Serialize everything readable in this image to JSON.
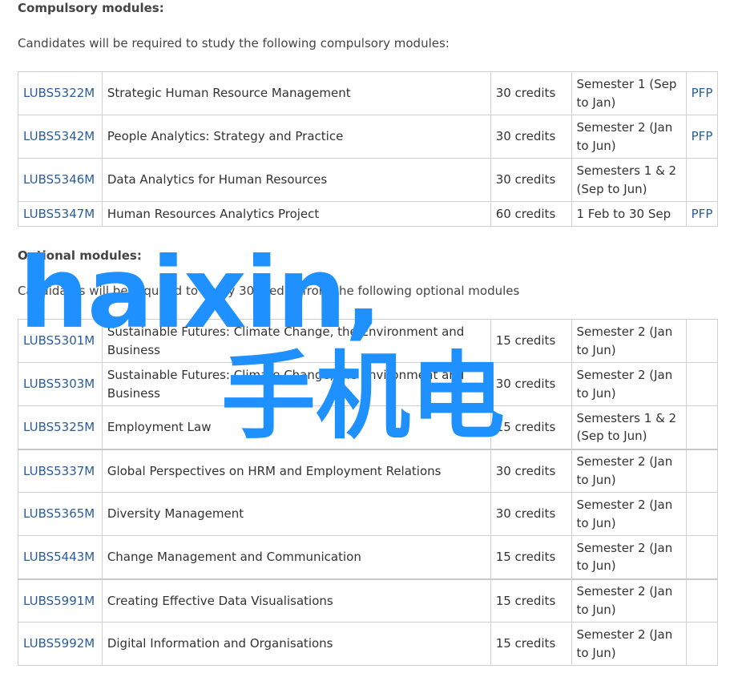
{
  "compulsory": {
    "heading": "Compulsory modules:",
    "intro": "Candidates will be required to study the following compulsory modules:",
    "rows": [
      {
        "code": "LUBS5322M",
        "title": "Strategic Human Resource Management",
        "credits": "30 credits",
        "semester": "Semester 1 (Sep to Jan)",
        "pfp": "PFP"
      },
      {
        "code": "LUBS5342M",
        "title": "People Analytics: Strategy and Practice",
        "credits": "30 credits",
        "semester": "Semester 2 (Jan to Jun)",
        "pfp": "PFP"
      },
      {
        "code": "LUBS5346M",
        "title": "Data Analytics for Human Resources",
        "credits": "30 credits",
        "semester": "Semesters 1 & 2 (Sep to Jun)",
        "pfp": ""
      },
      {
        "code": "LUBS5347M",
        "title": "Human Resources Analytics Project",
        "credits": "60 credits",
        "semester": "1 Feb to 30 Sep",
        "pfp": "PFP"
      }
    ]
  },
  "optional": {
    "heading": "Optional modules:",
    "intro": "Candidates will be required to study 30 credits from the following optional modules",
    "rows": [
      {
        "code": "LUBS5301M",
        "title": "Sustainable Futures: Climate Change, the Environment and Business",
        "credits": "15 credits",
        "semester": "Semester 2 (Jan to Jun)",
        "pfp": ""
      },
      {
        "code": "LUBS5303M",
        "title": "Sustainable Futures: Climate Change, the Environment and Business",
        "credits": "30 credits",
        "semester": "Semester 2 (Jan to Jun)",
        "pfp": ""
      },
      {
        "code": "LUBS5325M",
        "title": "Employment Law",
        "credits": "15 credits",
        "semester": "Semesters 1 & 2 (Sep to Jun)",
        "pfp": ""
      },
      {
        "code": "LUBS5337M",
        "title": "Global Perspectives on HRM and Employment Relations",
        "credits": "30 credits",
        "semester": "Semester 2 (Jan to Jun)",
        "pfp": ""
      },
      {
        "code": "LUBS5365M",
        "title": "Diversity Management",
        "credits": "30 credits",
        "semester": "Semester 2 (Jan to Jun)",
        "pfp": ""
      },
      {
        "code": "LUBS5443M",
        "title": "Change Management and Communication",
        "credits": "15 credits",
        "semester": "Semester 2 (Jan to Jun)",
        "pfp": ""
      },
      {
        "code": "LUBS5991M",
        "title": "Creating Effective Data Visualisations",
        "credits": "15 credits",
        "semester": "Semester 2 (Jan to Jun)",
        "pfp": ""
      },
      {
        "code": "LUBS5992M",
        "title": "Digital Information and Organisations",
        "credits": "15 credits",
        "semester": "Semester 2 (Jan to Jun)",
        "pfp": ""
      }
    ]
  },
  "watermark": {
    "line1": "haixin,",
    "line2": "手机电",
    "color": "#1e90ff"
  }
}
